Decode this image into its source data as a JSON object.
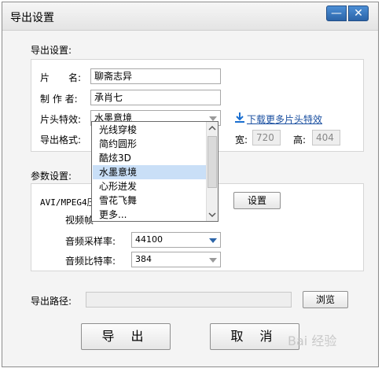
{
  "window": {
    "title": "导出设置",
    "min_symbol": "—",
    "close_symbol": "✕"
  },
  "export_settings": {
    "section_label": "导出设置:",
    "name_label": "片　　名:",
    "name_value": "聊斋志异",
    "producer_label": "制 作 者:",
    "producer_value": "承肖七",
    "intro_effect_label": "片头特效:",
    "intro_effect_value": "水墨意境",
    "download_link": "下载更多片头特效",
    "format_label": "导出格式:",
    "width_label": "宽:",
    "width_value": "720",
    "height_label": "高:",
    "height_value": "404"
  },
  "dropdown": {
    "items": [
      "光线穿梭",
      "简约圆形",
      "酷炫3D",
      "水墨意境",
      "心形迸发",
      "雪花飞舞",
      "更多..."
    ],
    "selected_index": 3
  },
  "params": {
    "section_label": "参数设置:",
    "codec_label": "AVI/MPEG4压",
    "settings_button": "设置",
    "video_frame_label": "视频帧",
    "sample_rate_label": "音频采样率:",
    "sample_rate_value": "44100",
    "bitrate_label": "音频比特率:",
    "bitrate_value": "384"
  },
  "path": {
    "label": "导出路径:",
    "value": "",
    "browse_button": "浏览"
  },
  "actions": {
    "export_button": "导 出",
    "cancel_button": "取 消"
  },
  "watermark": "Bai 经验"
}
